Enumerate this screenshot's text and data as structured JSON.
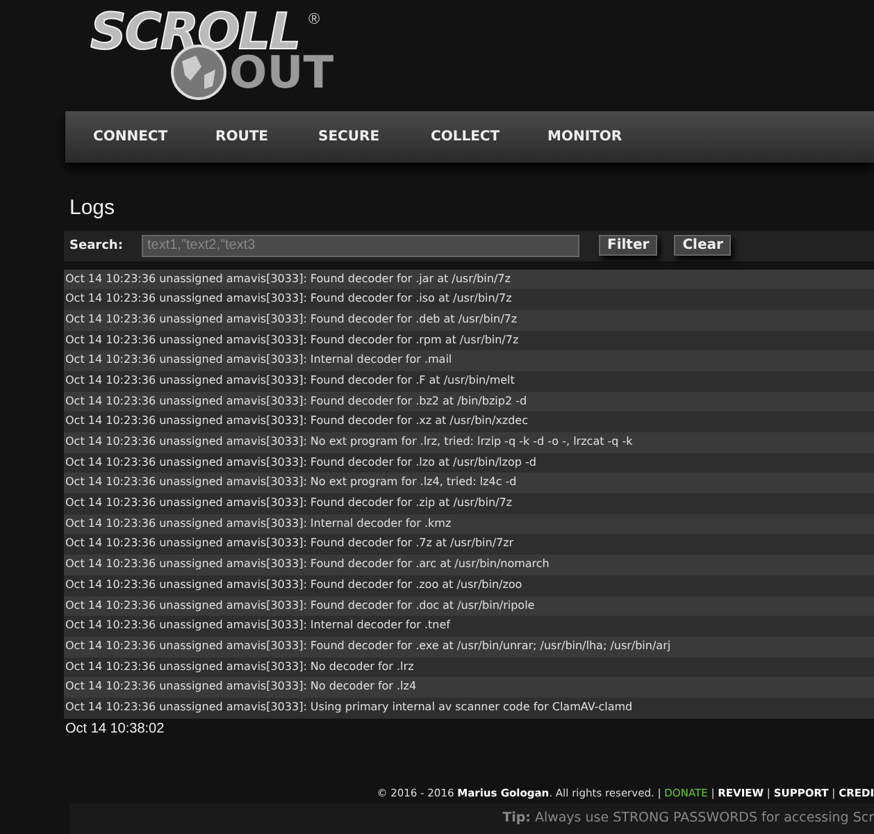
{
  "logo": {
    "top": "SCROLL",
    "bottom": "OUT",
    "mark": "®"
  },
  "nav": [
    "CONNECT",
    "ROUTE",
    "SECURE",
    "COLLECT",
    "MONITOR"
  ],
  "page_title": "Logs",
  "search": {
    "label": "Search:",
    "placeholder": "text1,\"text2,\"text3",
    "buttons": [
      "Filter",
      "Clear"
    ]
  },
  "log_lines": [
    "Oct 14 10:23:36 unassigned amavis[3033]: Found decoder for .jar at /usr/bin/7z",
    "Oct 14 10:23:36 unassigned amavis[3033]: Found decoder for .iso at /usr/bin/7z",
    "Oct 14 10:23:36 unassigned amavis[3033]: Found decoder for .deb at /usr/bin/7z",
    "Oct 14 10:23:36 unassigned amavis[3033]: Found decoder for .rpm at /usr/bin/7z",
    "Oct 14 10:23:36 unassigned amavis[3033]: Internal decoder for .mail",
    "Oct 14 10:23:36 unassigned amavis[3033]: Found decoder for .F at /usr/bin/melt",
    "Oct 14 10:23:36 unassigned amavis[3033]: Found decoder for .bz2 at /bin/bzip2 -d",
    "Oct 14 10:23:36 unassigned amavis[3033]: Found decoder for .xz at /usr/bin/xzdec",
    "Oct 14 10:23:36 unassigned amavis[3033]: No ext program for .lrz, tried: lrzip -q -k -d -o -, lrzcat -q -k",
    "Oct 14 10:23:36 unassigned amavis[3033]: Found decoder for .lzo at /usr/bin/lzop -d",
    "Oct 14 10:23:36 unassigned amavis[3033]: No ext program for .lz4, tried: lz4c -d",
    "Oct 14 10:23:36 unassigned amavis[3033]: Found decoder for .zip at /usr/bin/7z",
    "Oct 14 10:23:36 unassigned amavis[3033]: Internal decoder for .kmz",
    "Oct 14 10:23:36 unassigned amavis[3033]: Found decoder for .7z at /usr/bin/7zr",
    "Oct 14 10:23:36 unassigned amavis[3033]: Found decoder for .arc at /usr/bin/nomarch",
    "Oct 14 10:23:36 unassigned amavis[3033]: Found decoder for .zoo at /usr/bin/zoo",
    "Oct 14 10:23:36 unassigned amavis[3033]: Found decoder for .doc at /usr/bin/ripole",
    "Oct 14 10:23:36 unassigned amavis[3033]: Internal decoder for .tnef",
    "Oct 14 10:23:36 unassigned amavis[3033]: Found decoder for .exe at /usr/bin/unrar; /usr/bin/lha; /usr/bin/arj",
    "Oct 14 10:23:36 unassigned amavis[3033]: No decoder for .lrz",
    "Oct 14 10:23:36 unassigned amavis[3033]: No decoder for .lz4",
    "Oct 14 10:23:36 unassigned amavis[3033]: Using primary internal av scanner code for ClamAV-clamd"
  ],
  "timestamp": "Oct 14 10:38:02",
  "footer": {
    "copyright": "© 2016 - 2016 **Marius Gologan**. All rights reserved.",
    "links": [
      {
        "separator": "|",
        "label": "DONATE",
        "kind": "highlight"
      },
      {
        "separator": "|",
        "label": "REVIEW",
        "kind": "plain"
      },
      {
        "separator": "|",
        "label": "SUPPORT",
        "kind": "plain"
      },
      {
        "separator": "|",
        "label": "CREDI",
        "kind": "plain"
      }
    ]
  },
  "tip": "**Tip:** Always use STRONG PASSWORDS for accessing Scr"
}
